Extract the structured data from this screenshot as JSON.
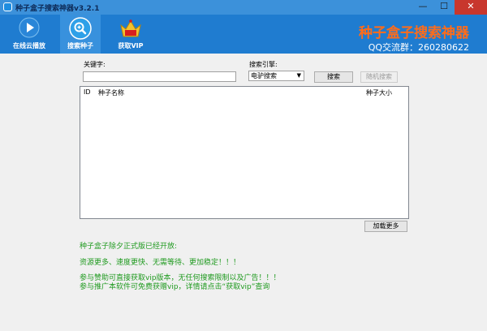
{
  "window": {
    "title": "种子盒子搜索神器v3.2.1",
    "controls": {
      "minimize": "—",
      "maximize": "☐",
      "close": "✕"
    }
  },
  "toolbar": {
    "buttons": [
      {
        "label": "在线云播放",
        "icon": "play-icon",
        "active": false
      },
      {
        "label": "搜索种子",
        "icon": "search-icon",
        "active": true
      },
      {
        "label": "获取VIP",
        "icon": "vip-icon",
        "active": false
      }
    ],
    "brand_title": "种子盒子搜索神器",
    "qq_line": "QQ交流群：260280622"
  },
  "search": {
    "keyword_label": "关键字:",
    "keyword_value": "",
    "engine_label": "搜索引擎:",
    "engine_selected": "电驴搜索",
    "search_button": "搜索",
    "random_button": "随机搜索"
  },
  "results": {
    "columns": [
      "ID",
      "种子名称",
      "种子大小"
    ],
    "rows": []
  },
  "load_more_button": "加载更多",
  "notices": [
    "种子盒子除夕正式版已经开放:",
    "资源更多、速度更快、无需等待、更加稳定！！！",
    "参与赞助可直接获取vip版本，无任何搜索限制以及广告！！！",
    "参与推广本软件可免费获赠vip，详情请点击“获取vip”查询"
  ],
  "colors": {
    "titlebar": "#3c91da",
    "toolbar": "#1f7cd0",
    "brand": "#ff6c1a",
    "notice_text": "#1f9a1f"
  }
}
